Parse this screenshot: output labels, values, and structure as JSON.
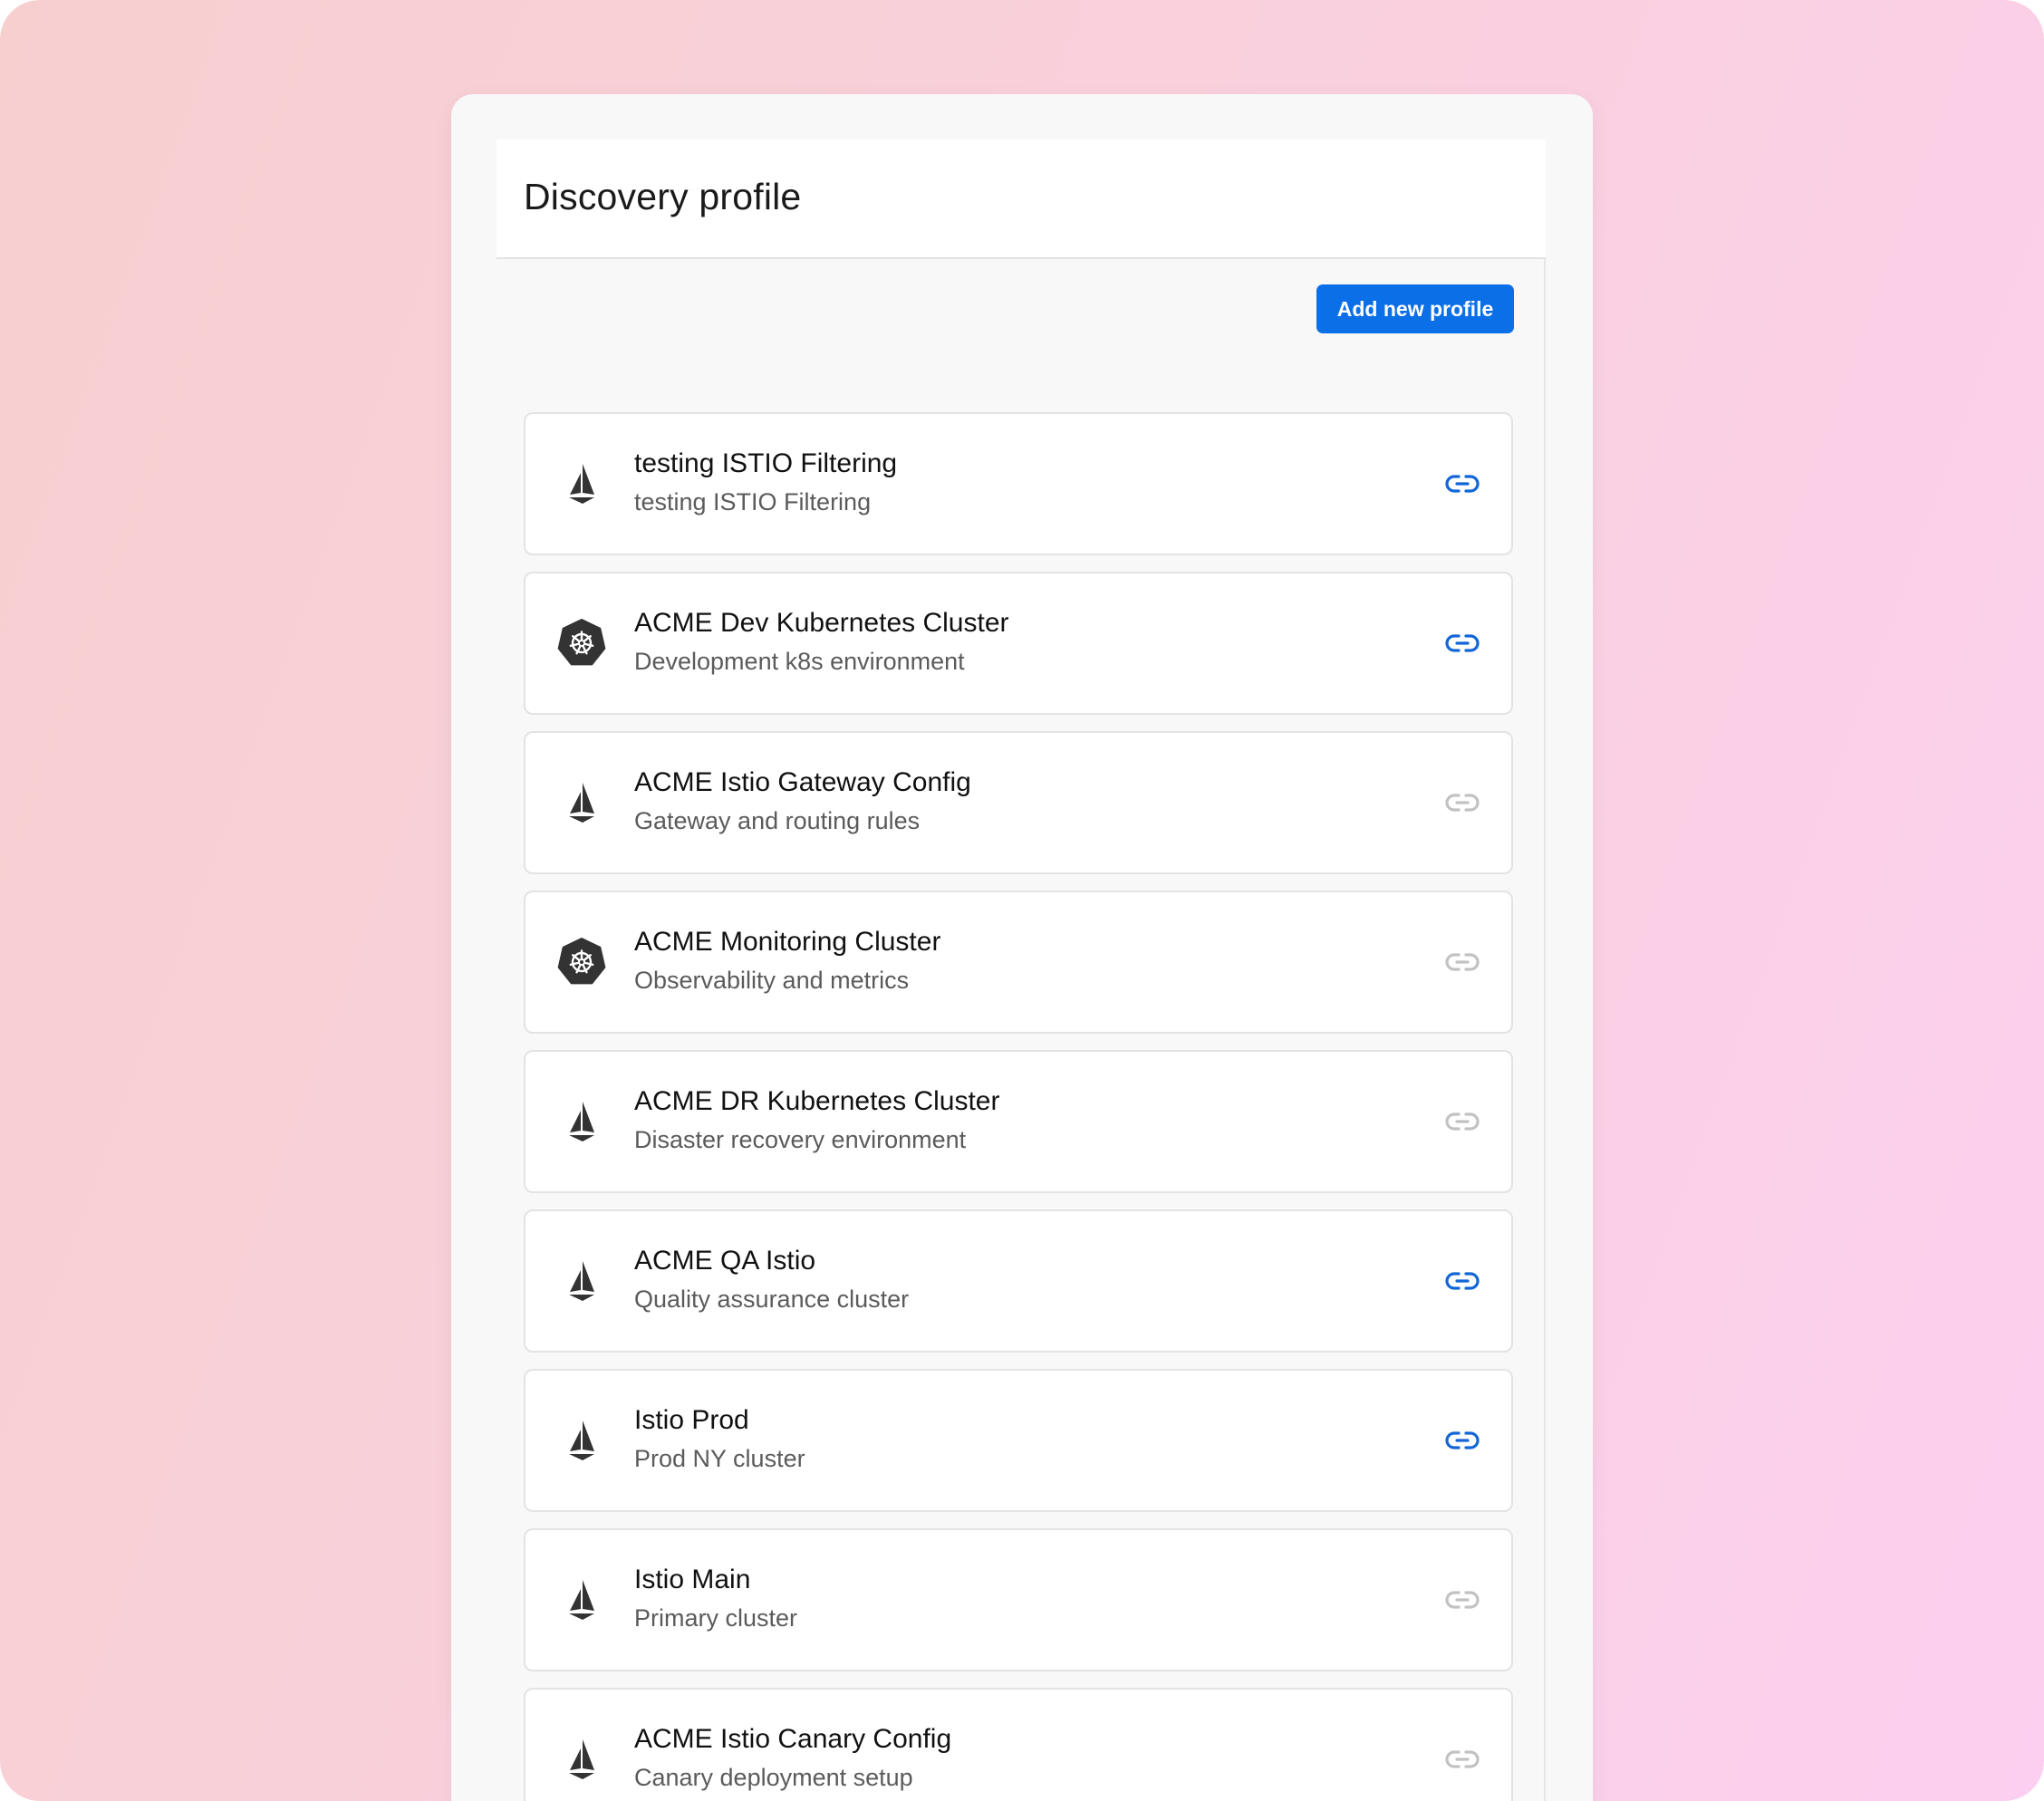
{
  "page": {
    "title": "Discovery profile",
    "add_button_label": "Add new profile"
  },
  "colors": {
    "accent": "#0b6fe8",
    "link_active": "#1266d6",
    "link_inactive": "#c2c2c2",
    "icon_dark": "#333333"
  },
  "profiles": [
    {
      "title": "testing ISTIO Filtering",
      "description": "testing ISTIO Filtering",
      "icon": "istio-icon",
      "linked": true
    },
    {
      "title": "ACME Dev Kubernetes Cluster",
      "description": "Development k8s environment",
      "icon": "kubernetes-icon",
      "linked": true
    },
    {
      "title": "ACME Istio Gateway Config",
      "description": "Gateway and routing rules",
      "icon": "istio-icon",
      "linked": false
    },
    {
      "title": "ACME Monitoring Cluster",
      "description": "Observability and metrics",
      "icon": "kubernetes-icon",
      "linked": false
    },
    {
      "title": "ACME DR Kubernetes Cluster",
      "description": "Disaster recovery environment",
      "icon": "istio-icon",
      "linked": false
    },
    {
      "title": "ACME QA Istio",
      "description": "Quality assurance cluster",
      "icon": "istio-icon",
      "linked": true
    },
    {
      "title": "Istio Prod",
      "description": "Prod NY cluster",
      "icon": "istio-icon",
      "linked": true
    },
    {
      "title": "Istio Main",
      "description": "Primary cluster",
      "icon": "istio-icon",
      "linked": false
    },
    {
      "title": "ACME Istio Canary Config",
      "description": "Canary deployment setup",
      "icon": "istio-icon",
      "linked": false
    }
  ]
}
